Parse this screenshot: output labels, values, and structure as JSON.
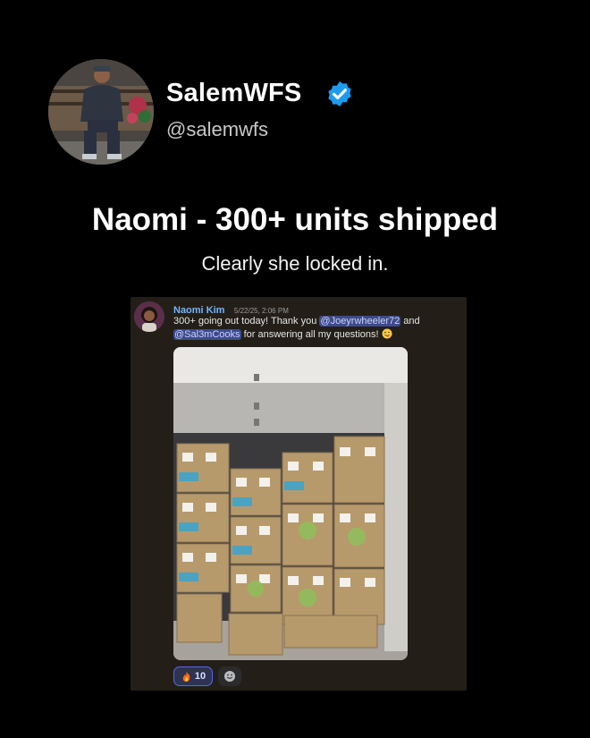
{
  "profile": {
    "display_name": "SalemWFS",
    "handle": "@salemwfs",
    "verified": true,
    "avatar_icon": "person-avatar",
    "verified_icon": "verified-badge-icon",
    "verified_color": "#1d9bf0"
  },
  "post": {
    "headline": "Naomi - 300+ units shipped",
    "subhead": "Clearly she locked in."
  },
  "chat": {
    "author": "Naomi Kim",
    "timestamp": "5/22/25, 2:06 PM",
    "message_part1": "300+ going out today! Thank you ",
    "mention1": "@Joeyrwheeler72",
    "message_part2": " and ",
    "mention2": "@Sal3mCooks",
    "message_part3": " for answering all my questions! ",
    "end_emoji": "winking-face-tongue-emoji",
    "photo_description_icon": "stacked-boxes-garage-photo",
    "reaction": {
      "emoji": "fire-emoji",
      "count": "10"
    },
    "add_reaction_icon": "add-reaction-icon",
    "author_color": "#6fb6ff",
    "mention_bg": "#3e4a8c"
  }
}
